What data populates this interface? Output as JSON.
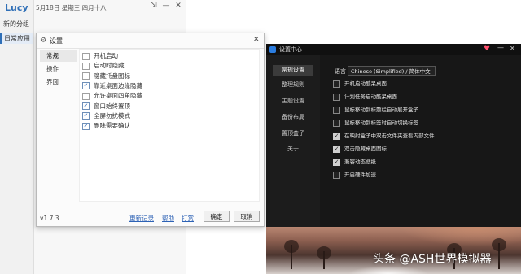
{
  "lucy": {
    "app_name": "Lucy",
    "date": "5月18日 星期三 四月十八",
    "new_group": "新的分组",
    "daily_apps": "日常应用",
    "pin_glyph": "⇲",
    "min_glyph": "—",
    "close_glyph": "✕"
  },
  "settings_dialog": {
    "title": "设置",
    "tabs": [
      "常规",
      "操作",
      "界面"
    ],
    "options": [
      {
        "label": "开机启动",
        "checked": false
      },
      {
        "label": "启动时隐藏",
        "checked": false
      },
      {
        "label": "隐藏托盘图标",
        "checked": false
      },
      {
        "label": "靠近桌面边缘隐藏",
        "checked": true
      },
      {
        "label": "允许桌面四角隐藏",
        "checked": false
      },
      {
        "label": "窗口始终置顶",
        "checked": true
      },
      {
        "label": "全屏勿扰模式",
        "checked": true
      },
      {
        "label": "删除需要确认",
        "checked": true
      }
    ],
    "version": "v1.7.3",
    "links": [
      "更新记录",
      "帮助",
      "打赏"
    ],
    "ok_label": "确定",
    "cancel_label": "取消"
  },
  "settings_center": {
    "title": "设置中心",
    "nav": [
      "常规设置",
      "整理规则",
      "主题设置",
      "备份布局",
      "置顶盒子",
      "关于"
    ],
    "language_label": "语言",
    "language_value": "Chinese (Simplified) / 简体中文",
    "options": [
      {
        "label": "开机启动酷呆桌面",
        "checked": false
      },
      {
        "label": "计划任务启动酷呆桌面",
        "checked": false
      },
      {
        "label": "鼠标移动到标题栏自动展开盒子",
        "checked": false
      },
      {
        "label": "鼠标移动到标签时自动切换标签",
        "checked": false
      },
      {
        "label": "在映射盒子中双击文件夹查看内部文件",
        "checked": true
      },
      {
        "label": "双击隐藏桌面图标",
        "checked": true
      },
      {
        "label": "兼容动态壁纸",
        "checked": true
      },
      {
        "label": "开启硬件加速",
        "checked": false
      }
    ]
  },
  "watermark": "头条 @ASH世界模拟器",
  "colors": {
    "accent_blue": "#2f6fb7",
    "dark_bg": "#171717",
    "heart": "#ff4f6d"
  }
}
